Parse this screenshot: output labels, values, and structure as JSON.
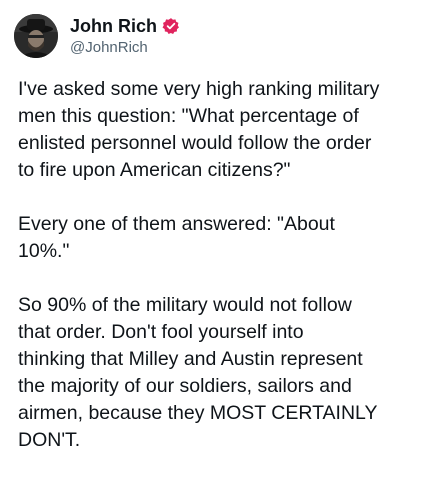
{
  "author": {
    "display_name": "John Rich",
    "handle": "@JohnRich",
    "verified": true,
    "avatar_icon": "profile-photo",
    "verified_icon": "verified-badge-icon",
    "verified_color": "#e0245e"
  },
  "post": {
    "paragraphs": [
      "I've asked some very high ranking military\nmen this question: \"What percentage of\nenlisted personnel would follow the order\nto fire upon American citizens?\"",
      "Every one of them answered: \"About\n10%.\"",
      "So 90% of the military would not follow\nthat order. Don't fool yourself into\nthinking that Milley and Austin represent\nthe majority of our soldiers, sailors and\nairmen, because they MOST CERTAINLY\nDON'T."
    ]
  }
}
